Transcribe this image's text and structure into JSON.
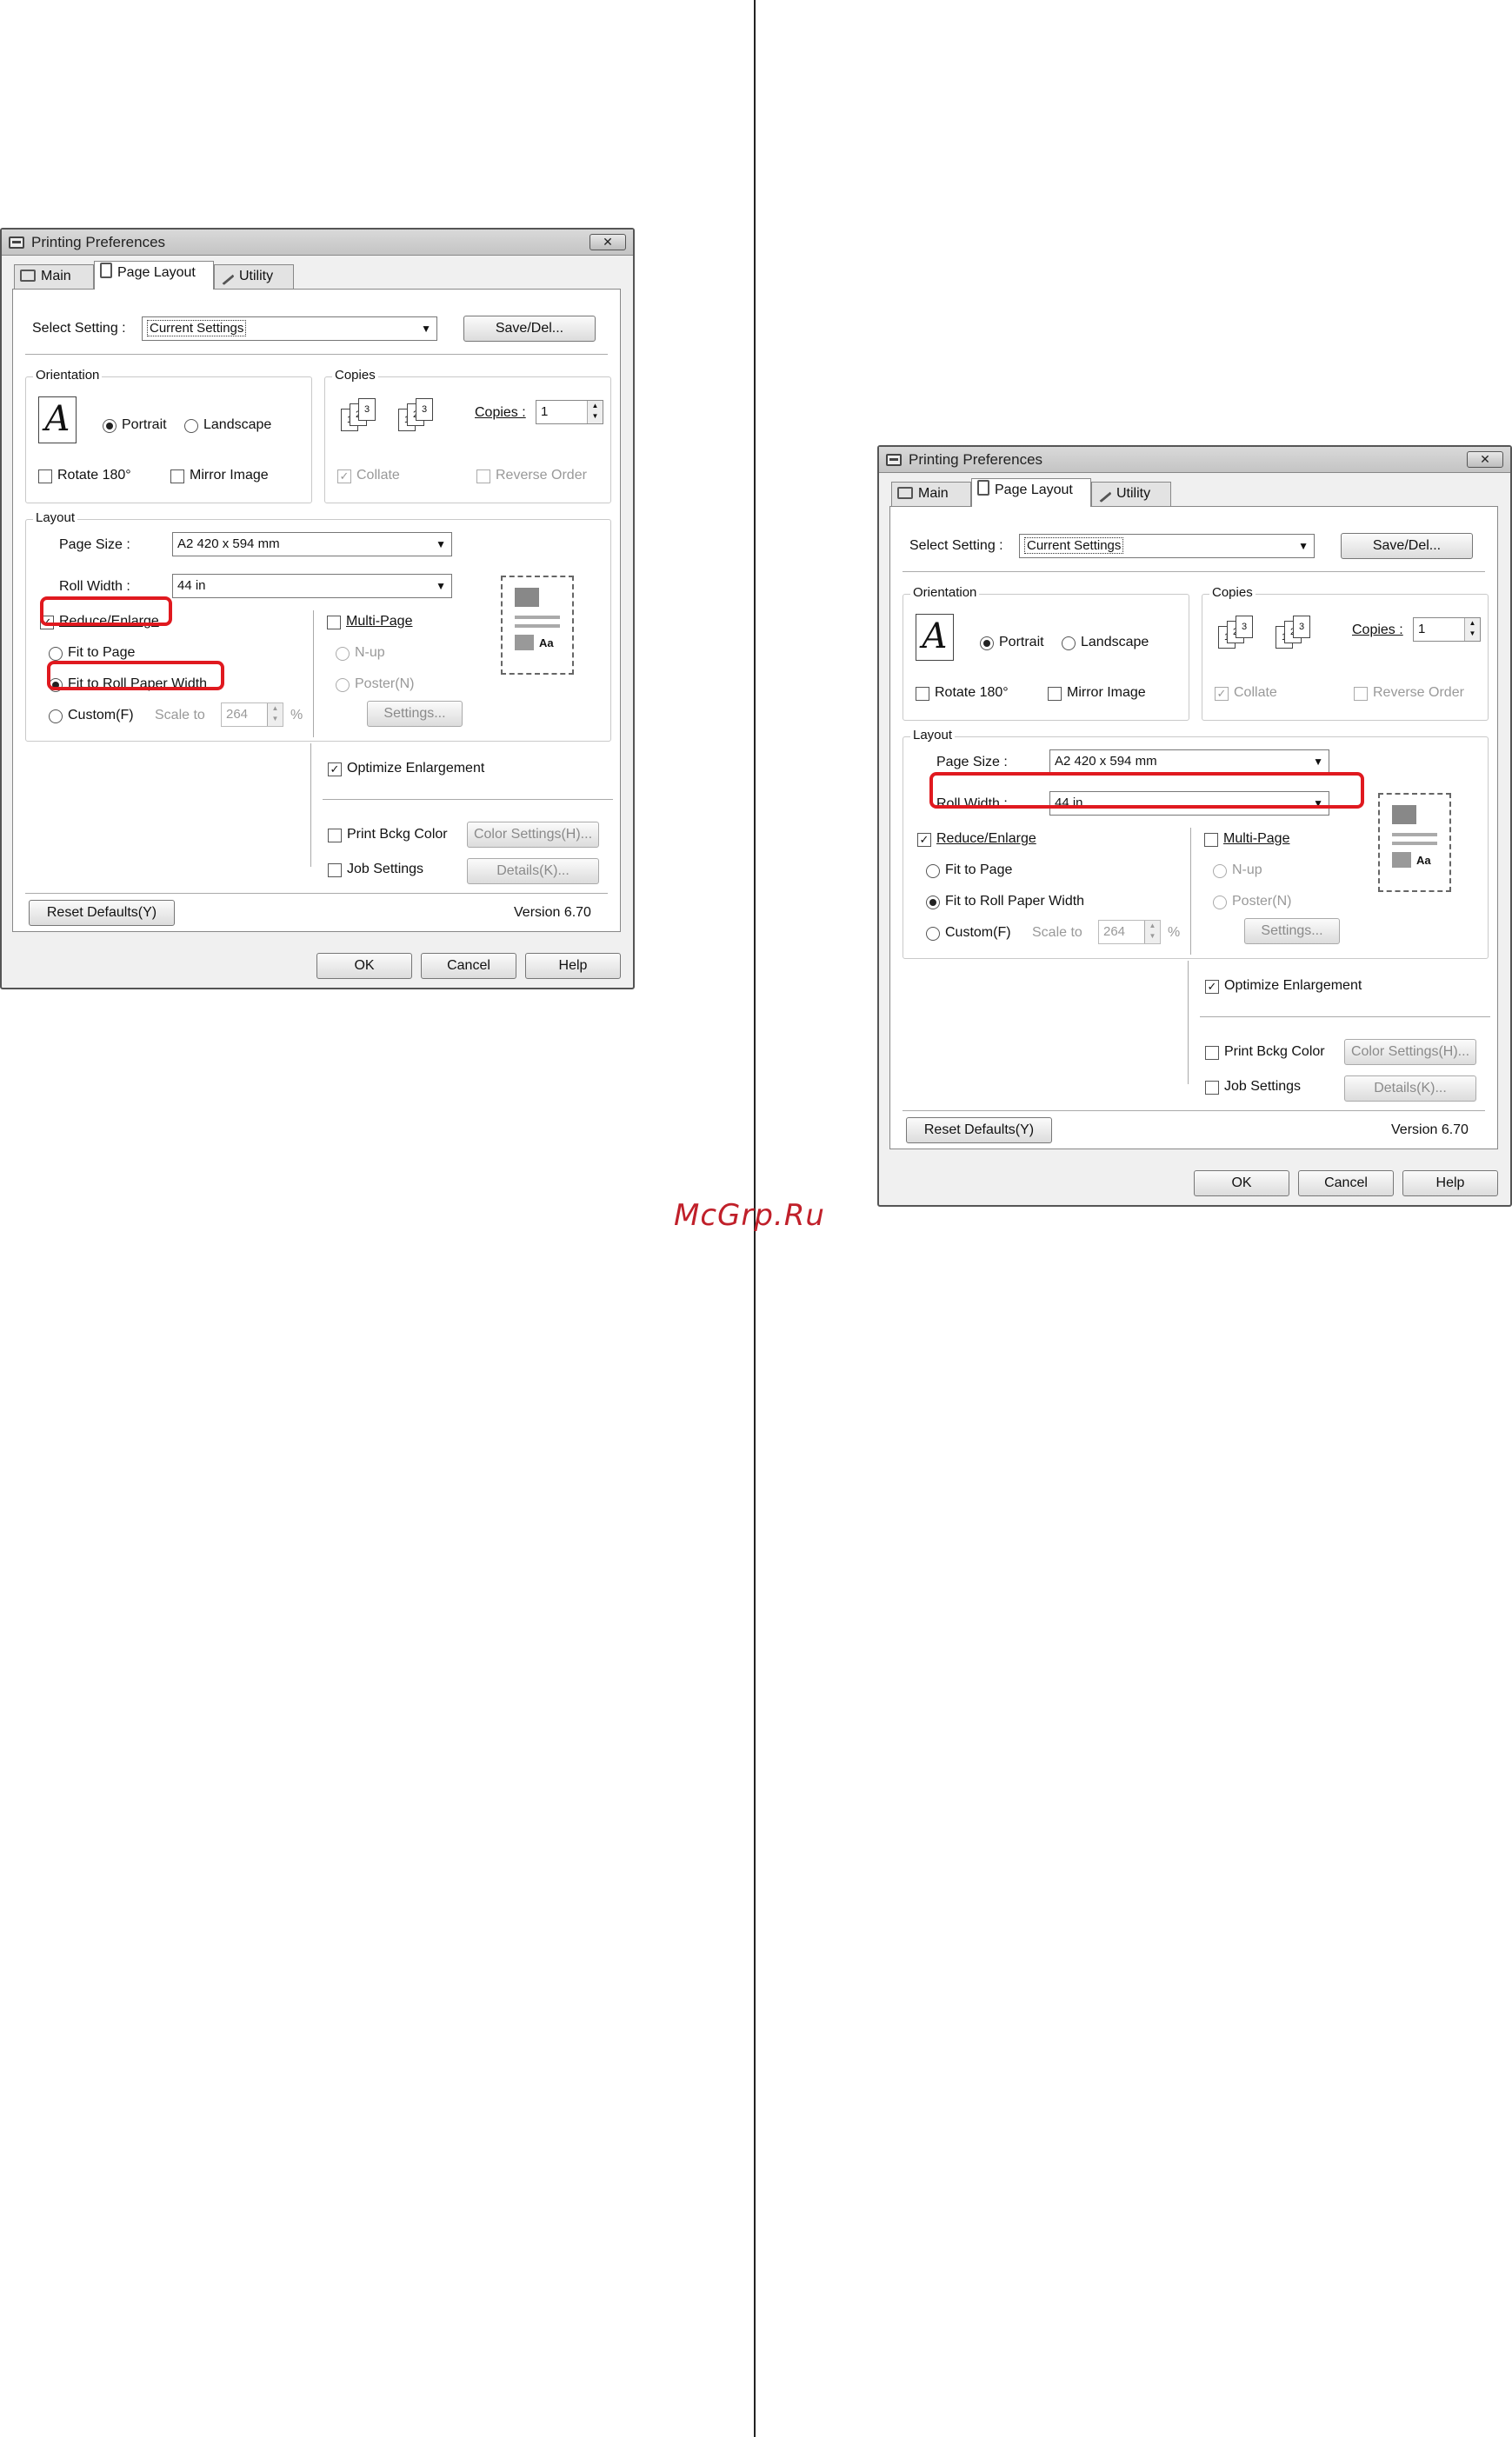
{
  "watermark": "McGrp.Ru",
  "dialog": {
    "title": "Printing Preferences",
    "close": "✕",
    "tabs": [
      "Main",
      "Page Layout",
      "Utility"
    ],
    "select_setting_label": "Select Setting :",
    "select_setting_value": "Current Settings",
    "save_del": "Save/Del...",
    "orientation": {
      "caption": "Orientation",
      "icon_glyph": "A",
      "portrait": "Portrait",
      "landscape": "Landscape",
      "rotate": "Rotate 180°",
      "mirror": "Mirror Image"
    },
    "copies": {
      "caption": "Copies",
      "label": "Copies :",
      "value": "1",
      "collate": "Collate",
      "reverse": "Reverse Order",
      "pages": [
        "1",
        "2",
        "3"
      ]
    },
    "layout": {
      "caption": "Layout",
      "page_size_label": "Page Size :",
      "page_size_value": "A2 420 x 594 mm",
      "roll_width_label": "Roll Width :",
      "roll_width_value": "44 in",
      "reduce_enlarge": "Reduce/Enlarge",
      "fit_to_page": "Fit to Page",
      "fit_to_roll": "Fit to Roll Paper Width",
      "custom": "Custom(F)",
      "scale_to": "Scale to",
      "scale_value": "264",
      "percent": "%",
      "multi_page": "Multi-Page",
      "n_up": "N-up",
      "poster": "Poster(N)",
      "settings": "Settings...",
      "preview_glyph": "Aa"
    },
    "optimize": "Optimize Enlargement",
    "print_bckg": "Print Bckg Color",
    "color_settings": "Color Settings(H)...",
    "job_settings": "Job Settings",
    "details": "Details(K)...",
    "reset_defaults": "Reset Defaults(Y)",
    "version": "Version 6.70",
    "ok": "OK",
    "cancel": "Cancel",
    "help": "Help",
    "check": "✓",
    "arrow_down": "▼",
    "spin_up": "▲",
    "spin_down": "▼"
  }
}
